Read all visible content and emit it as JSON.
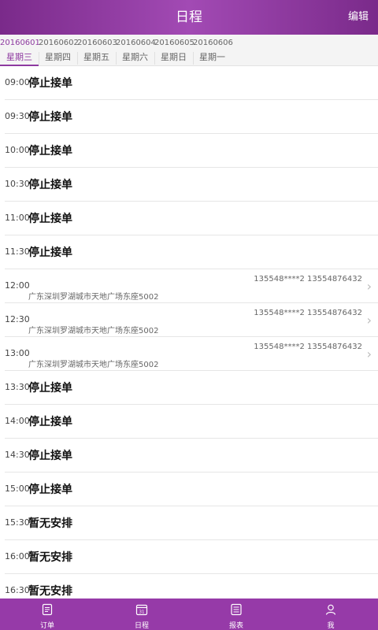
{
  "header": {
    "title": "日程",
    "edit_label": "编辑"
  },
  "tabs": [
    {
      "date": "20160601",
      "weekday": "星期三"
    },
    {
      "date": "20160602",
      "weekday": "星期四"
    },
    {
      "date": "20160603",
      "weekday": "星期五"
    },
    {
      "date": "20160604",
      "weekday": "星期六"
    },
    {
      "date": "20160605",
      "weekday": "星期日"
    },
    {
      "date": "20160606",
      "weekday": "星期一"
    }
  ],
  "rows": [
    {
      "time": "09:00",
      "status": "停止接单"
    },
    {
      "time": "09:30",
      "status": "停止接单"
    },
    {
      "time": "10:00",
      "status": "停止接单"
    },
    {
      "time": "10:30",
      "status": "停止接单"
    },
    {
      "time": "11:00",
      "status": "停止接单"
    },
    {
      "time": "11:30",
      "status": "停止接单"
    },
    {
      "time": "12:00",
      "phone": "135548****2 13554876432",
      "address": "广东深圳罗湖城市天地广场东座5002"
    },
    {
      "time": "12:30",
      "phone": "135548****2 13554876432",
      "address": "广东深圳罗湖城市天地广场东座5002"
    },
    {
      "time": "13:00",
      "phone": "135548****2 13554876432",
      "address": "广东深圳罗湖城市天地广场东座5002"
    },
    {
      "time": "13:30",
      "status": "停止接单"
    },
    {
      "time": "14:00",
      "status": "停止接单"
    },
    {
      "time": "14:30",
      "status": "停止接单"
    },
    {
      "time": "15:00",
      "status": "停止接单"
    },
    {
      "time": "15:30",
      "status": "暂无安排"
    },
    {
      "time": "16:00",
      "status": "暂无安排"
    },
    {
      "time": "16:30",
      "status": "暂无安排"
    }
  ],
  "bottom_nav": [
    {
      "label": "订单",
      "icon": "order-icon"
    },
    {
      "label": "日程",
      "icon": "calendar-icon",
      "badge": "31"
    },
    {
      "label": "报表",
      "icon": "report-icon"
    },
    {
      "label": "我",
      "icon": "user-icon"
    }
  ],
  "colors": {
    "header": "#8e3aa0",
    "bottom": "#963aa8",
    "accent": "#8e3aa0"
  }
}
